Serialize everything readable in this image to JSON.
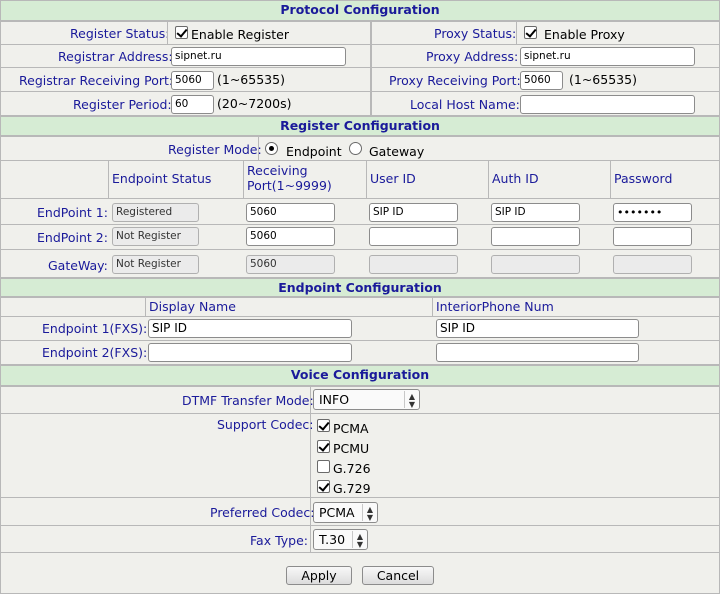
{
  "protocol": {
    "header": "Protocol Configuration",
    "register_status": {
      "label": "Register Status:",
      "checkbox_label": "Enable Register",
      "checked": true
    },
    "proxy_status": {
      "label": "Proxy Status:",
      "checkbox_label": "Enable Proxy",
      "checked": true
    },
    "registrar_address": {
      "label": "Registrar Address:",
      "value": "sipnet.ru"
    },
    "proxy_address": {
      "label": "Proxy Address:",
      "value": "sipnet.ru"
    },
    "registrar_port": {
      "label": "Registrar Receiving Port:",
      "value": "5060",
      "range": "(1~65535)"
    },
    "proxy_port": {
      "label": "Proxy Receiving Port:",
      "value": "5060",
      "range": "(1~65535)"
    },
    "register_period": {
      "label": "Register Period:",
      "value": "60",
      "range": "(20~7200s)"
    },
    "local_host_name": {
      "label": "Local Host Name:",
      "value": ""
    }
  },
  "register": {
    "header": "Register Configuration",
    "mode_label": "Register Mode:",
    "mode_options": [
      "Endpoint",
      "Gateway"
    ],
    "mode_selected": "Endpoint",
    "columns": [
      "Endpoint Status",
      "Receiving Port(1~9999)",
      "User ID",
      "Auth ID",
      "Password"
    ],
    "rows": [
      {
        "label": "EndPoint 1:",
        "status": "Registered",
        "port": "5060",
        "user_id": "SIP ID",
        "auth_id": "SIP ID",
        "password": "•••••••"
      },
      {
        "label": "EndPoint 2:",
        "status": "Not Register",
        "port": "5060",
        "user_id": "",
        "auth_id": "",
        "password": ""
      },
      {
        "label": "GateWay:",
        "status": "Not Register",
        "port": "5060",
        "user_id": "",
        "auth_id": "",
        "password": ""
      }
    ]
  },
  "endpoint": {
    "header": "Endpoint Configuration",
    "columns": [
      "Display Name",
      "InteriorPhone Num"
    ],
    "rows": [
      {
        "label": "Endpoint 1(FXS):",
        "display_name": "SIP ID",
        "interior": "SIP ID"
      },
      {
        "label": "Endpoint 2(FXS):",
        "display_name": "",
        "interior": ""
      }
    ]
  },
  "voice": {
    "header": "Voice Configuration",
    "dtmf": {
      "label": "DTMF Transfer Mode:",
      "value": "INFO"
    },
    "codec_label": "Support Codec:",
    "codecs": [
      {
        "name": "PCMA",
        "checked": true
      },
      {
        "name": "PCMU",
        "checked": true
      },
      {
        "name": "G.726",
        "checked": false
      },
      {
        "name": "G.729",
        "checked": true
      }
    ],
    "preferred": {
      "label": "Preferred Codec:",
      "value": "PCMA"
    },
    "fax": {
      "label": "Fax Type:",
      "value": "T.30"
    }
  },
  "buttons": {
    "apply": "Apply",
    "cancel": "Cancel"
  }
}
